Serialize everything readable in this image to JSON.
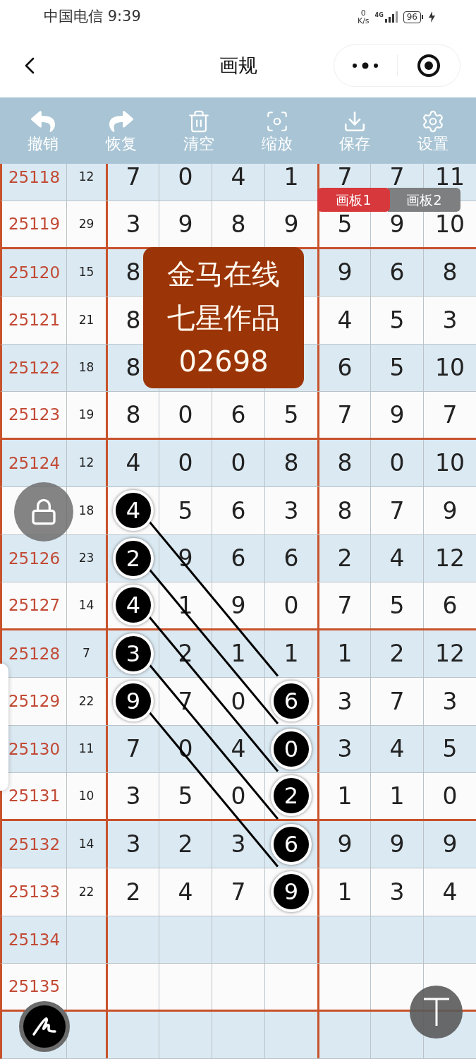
{
  "status_bar": {
    "carrier_time": "中国电信 9:39",
    "speed_value": "0",
    "speed_unit": "K/s",
    "network": "4G",
    "battery": "96",
    "charging": true
  },
  "nav": {
    "title": "画规"
  },
  "toolbar": [
    {
      "kind": "undo",
      "label": "撤销"
    },
    {
      "kind": "redo",
      "label": "恢复"
    },
    {
      "kind": "clear",
      "label": "清空"
    },
    {
      "kind": "zoom",
      "label": "缩放"
    },
    {
      "kind": "save",
      "label": "保存"
    },
    {
      "kind": "settings",
      "label": "设置"
    }
  ],
  "board_tabs": [
    {
      "label": "画板1",
      "selected": true
    },
    {
      "label": "画板2",
      "selected": false
    }
  ],
  "stamp": {
    "lines": [
      "金马在线",
      "七星作品",
      "02698"
    ]
  },
  "grid": {
    "rows": [
      {
        "period": "25118",
        "sum": "12",
        "cells": [
          {
            "text": "7",
            "circled": false
          },
          {
            "text": "0",
            "circled": false
          },
          {
            "text": "4",
            "circled": false
          },
          {
            "text": "1",
            "circled": false
          },
          {
            "text": "7",
            "circled": false
          },
          {
            "text": "7",
            "circled": false
          },
          {
            "text": "11",
            "circled": false
          }
        ]
      },
      {
        "period": "25119",
        "sum": "29",
        "cells": [
          {
            "text": "3",
            "circled": false
          },
          {
            "text": "9",
            "circled": false
          },
          {
            "text": "8",
            "circled": false
          },
          {
            "text": "9",
            "circled": false
          },
          {
            "text": "5",
            "circled": false
          },
          {
            "text": "9",
            "circled": false
          },
          {
            "text": "10",
            "circled": false
          }
        ]
      },
      {
        "period": "25120",
        "sum": "15",
        "cells": [
          {
            "text": "8",
            "circled": false
          },
          null,
          null,
          null,
          {
            "text": "9",
            "circled": false
          },
          {
            "text": "6",
            "circled": false
          },
          {
            "text": "8",
            "circled": false
          }
        ]
      },
      {
        "period": "25121",
        "sum": "21",
        "cells": [
          {
            "text": "8",
            "circled": false
          },
          null,
          null,
          null,
          {
            "text": "4",
            "circled": false
          },
          {
            "text": "5",
            "circled": false
          },
          {
            "text": "3",
            "circled": false
          }
        ]
      },
      {
        "period": "25122",
        "sum": "18",
        "cells": [
          {
            "text": "8",
            "circled": false
          },
          null,
          null,
          null,
          {
            "text": "6",
            "circled": false
          },
          {
            "text": "5",
            "circled": false
          },
          {
            "text": "10",
            "circled": false
          }
        ]
      },
      {
        "period": "25123",
        "sum": "19",
        "cells": [
          {
            "text": "8",
            "circled": false
          },
          {
            "text": "0",
            "circled": false
          },
          {
            "text": "6",
            "circled": false
          },
          {
            "text": "5",
            "circled": false
          },
          {
            "text": "7",
            "circled": false
          },
          {
            "text": "9",
            "circled": false
          },
          {
            "text": "7",
            "circled": false
          }
        ]
      },
      {
        "period": "25124",
        "sum": "12",
        "cells": [
          {
            "text": "4",
            "circled": false
          },
          {
            "text": "0",
            "circled": false
          },
          {
            "text": "0",
            "circled": false
          },
          {
            "text": "8",
            "circled": false
          },
          {
            "text": "8",
            "circled": false
          },
          {
            "text": "0",
            "circled": false
          },
          {
            "text": "10",
            "circled": false
          }
        ]
      },
      {
        "sum": "18",
        "cells": [
          {
            "text": "4",
            "circled": true
          },
          {
            "text": "5",
            "circled": false
          },
          {
            "text": "6",
            "circled": false
          },
          {
            "text": "3",
            "circled": false
          },
          {
            "text": "8",
            "circled": false
          },
          {
            "text": "7",
            "circled": false
          },
          {
            "text": "9",
            "circled": false
          }
        ]
      },
      {
        "period": "25126",
        "sum": "23",
        "cells": [
          {
            "text": "2",
            "circled": true
          },
          {
            "text": "9",
            "circled": false
          },
          {
            "text": "6",
            "circled": false
          },
          {
            "text": "6",
            "circled": false
          },
          {
            "text": "2",
            "circled": false
          },
          {
            "text": "4",
            "circled": false
          },
          {
            "text": "12",
            "circled": false
          }
        ]
      },
      {
        "period": "25127",
        "sum": "14",
        "cells": [
          {
            "text": "4",
            "circled": true
          },
          {
            "text": "1",
            "circled": false
          },
          {
            "text": "9",
            "circled": false
          },
          {
            "text": "0",
            "circled": false
          },
          {
            "text": "7",
            "circled": false
          },
          {
            "text": "5",
            "circled": false
          },
          {
            "text": "6",
            "circled": false
          }
        ]
      },
      {
        "period": "25128",
        "sum": "7",
        "cells": [
          {
            "text": "3",
            "circled": true
          },
          {
            "text": "2",
            "circled": false
          },
          {
            "text": "1",
            "circled": false
          },
          {
            "text": "1",
            "circled": false
          },
          {
            "text": "1",
            "circled": false
          },
          {
            "text": "2",
            "circled": false
          },
          {
            "text": "12",
            "circled": false
          }
        ]
      },
      {
        "period": "25129",
        "sum": "22",
        "cells": [
          {
            "text": "9",
            "circled": true
          },
          {
            "text": "7",
            "circled": false
          },
          {
            "text": "0",
            "circled": false
          },
          {
            "text": "6",
            "circled": true
          },
          {
            "text": "3",
            "circled": false
          },
          {
            "text": "7",
            "circled": false
          },
          {
            "text": "3",
            "circled": false
          }
        ]
      },
      {
        "period": "25130",
        "sum": "11",
        "cells": [
          {
            "text": "7",
            "circled": false
          },
          {
            "text": "0",
            "circled": false
          },
          {
            "text": "4",
            "circled": false
          },
          {
            "text": "0",
            "circled": true
          },
          {
            "text": "3",
            "circled": false
          },
          {
            "text": "4",
            "circled": false
          },
          {
            "text": "5",
            "circled": false
          }
        ]
      },
      {
        "period": "25131",
        "sum": "10",
        "cells": [
          {
            "text": "3",
            "circled": false
          },
          {
            "text": "5",
            "circled": false
          },
          {
            "text": "0",
            "circled": false
          },
          {
            "text": "2",
            "circled": true
          },
          {
            "text": "1",
            "circled": false
          },
          {
            "text": "1",
            "circled": false
          },
          {
            "text": "0",
            "circled": false
          }
        ]
      },
      {
        "period": "25132",
        "sum": "14",
        "cells": [
          {
            "text": "3",
            "circled": false
          },
          {
            "text": "2",
            "circled": false
          },
          {
            "text": "3",
            "circled": false
          },
          {
            "text": "6",
            "circled": true
          },
          {
            "text": "9",
            "circled": false
          },
          {
            "text": "9",
            "circled": false
          },
          {
            "text": "9",
            "circled": false
          }
        ]
      },
      {
        "period": "25133",
        "sum": "22",
        "cells": [
          {
            "text": "2",
            "circled": false
          },
          {
            "text": "4",
            "circled": false
          },
          {
            "text": "7",
            "circled": false
          },
          {
            "text": "9",
            "circled": true
          },
          {
            "text": "1",
            "circled": false
          },
          {
            "text": "3",
            "circled": false
          },
          {
            "text": "4",
            "circled": false
          }
        ]
      },
      {
        "period": "25134"
      },
      {
        "period": "25135"
      },
      {}
    ]
  }
}
